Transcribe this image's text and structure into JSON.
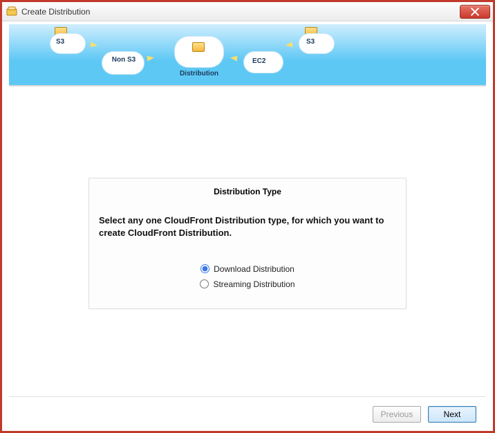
{
  "window": {
    "title": "Create Distribution"
  },
  "banner": {
    "labels": {
      "s3_left": "S3",
      "non_s3": "Non S3",
      "distribution": "Distribution",
      "ec2": "EC2",
      "s3_right": "S3"
    }
  },
  "panel": {
    "heading": "Distribution Type",
    "instruction": "Select any one CloudFront Distribution type, for which you want to create CloudFront Distribution.",
    "options": {
      "download": {
        "label": "Download Distribution",
        "selected": true
      },
      "streaming": {
        "label": "Streaming Distribution",
        "selected": false
      }
    }
  },
  "footer": {
    "previous": "Previous",
    "next": "Next"
  }
}
